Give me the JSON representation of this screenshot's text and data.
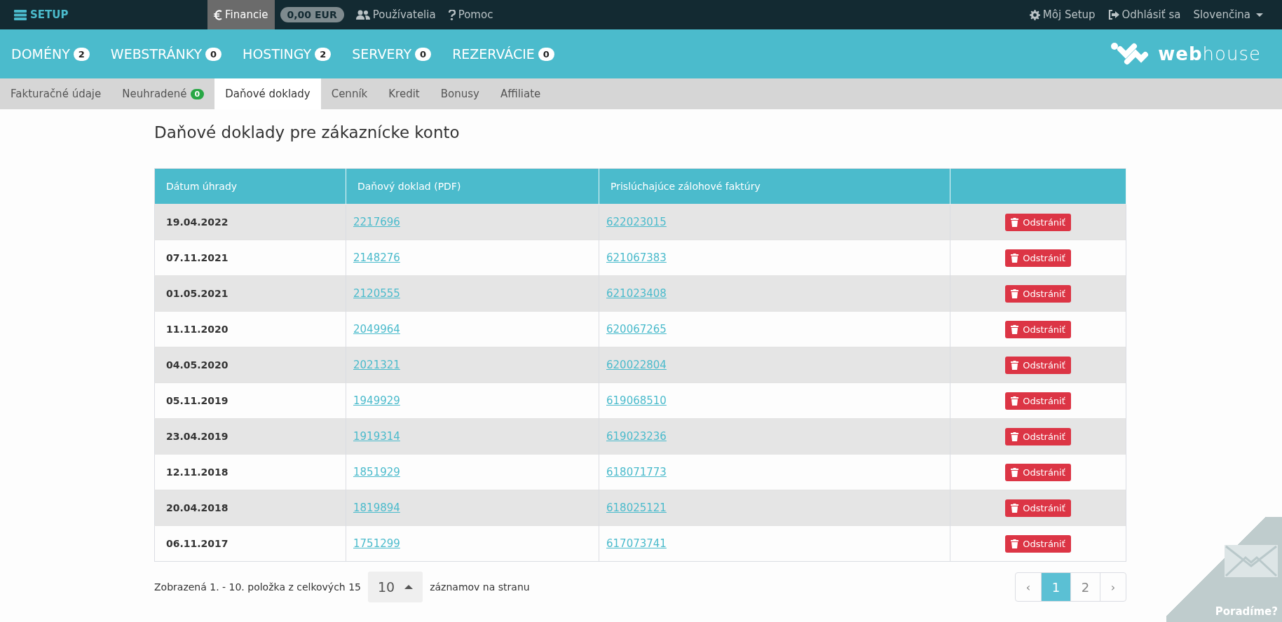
{
  "top_bar": {
    "brand": "SETUP",
    "left_items": [
      {
        "label": "Financie",
        "kind": "link",
        "selected": true
      },
      {
        "label": "0,00 EUR",
        "kind": "pill",
        "selected": false
      },
      {
        "label": "Používatelia",
        "kind": "link",
        "selected": false
      },
      {
        "label": "Pomoc",
        "kind": "link",
        "selected": false
      }
    ],
    "right_items": [
      {
        "label": "Môj Setup",
        "kind": "link"
      },
      {
        "label": "Odhlásiť sa",
        "kind": "link"
      },
      {
        "label": "Slovenčina",
        "kind": "dropdown"
      }
    ]
  },
  "main_nav": {
    "items": [
      {
        "label": "DOMÉNY",
        "count": "2"
      },
      {
        "label": "WEBSTRÁNKY",
        "count": "0"
      },
      {
        "label": "HOSTINGY",
        "count": "2"
      },
      {
        "label": "SERVERY",
        "count": "0"
      },
      {
        "label": "REZERVÁCIE",
        "count": "0"
      }
    ],
    "logo_text": "**web**house"
  },
  "tabs": [
    {
      "label": "Fakturačné údaje",
      "selected": false
    },
    {
      "label": "Neuhradené",
      "badge": "0",
      "selected": false
    },
    {
      "label": "Daňové doklady",
      "selected": true
    },
    {
      "label": "Cenník",
      "selected": false
    },
    {
      "label": "Kredit",
      "selected": false
    },
    {
      "label": "Bonusy",
      "selected": false
    },
    {
      "label": "Affiliate",
      "selected": false
    }
  ],
  "page_title": "Daňové doklady pre zákaznícke konto",
  "table": {
    "columns": [
      "Dátum úhrady",
      "Daňový doklad (PDF)",
      "Prislúchajúce zálohové faktúry"
    ],
    "rows": [
      {
        "date": "19.04.2022",
        "document": "2217696",
        "invoice": "622023015",
        "action": "Odstrániť"
      },
      {
        "date": "07.11.2021",
        "document": "2148276",
        "invoice": "621067383",
        "action": "Odstrániť"
      },
      {
        "date": "01.05.2021",
        "document": "2120555",
        "invoice": "621023408",
        "action": "Odstrániť"
      },
      {
        "date": "11.11.2020",
        "document": "2049964",
        "invoice": "620067265",
        "action": "Odstrániť"
      },
      {
        "date": "04.05.2020",
        "document": "2021321",
        "invoice": "620022804",
        "action": "Odstrániť"
      },
      {
        "date": "05.11.2019",
        "document": "1949929",
        "invoice": "619068510",
        "action": "Odstrániť"
      },
      {
        "date": "23.04.2019",
        "document": "1919314",
        "invoice": "619023236",
        "action": "Odstrániť"
      },
      {
        "date": "12.11.2018",
        "document": "1851929",
        "invoice": "618071773",
        "action": "Odstrániť"
      },
      {
        "date": "20.04.2018",
        "document": "1819894",
        "invoice": "618025121",
        "action": "Odstrániť"
      },
      {
        "date": "06.11.2017",
        "document": "1751299",
        "invoice": "617073741",
        "action": "Odstrániť"
      }
    ]
  },
  "footer": {
    "summary": "Zobrazená 1. - 10. položka z celkových 15",
    "page_size": "10",
    "page_size_suffix": "záznamov na stranu",
    "pagination": [
      {
        "label": "‹",
        "kind": "prev",
        "selected": false
      },
      {
        "label": "1",
        "kind": "page",
        "selected": true
      },
      {
        "label": "2",
        "kind": "page",
        "selected": false
      },
      {
        "label": "›",
        "kind": "next",
        "selected": false
      }
    ]
  },
  "help_corner": {
    "label": "Poradíme?"
  }
}
